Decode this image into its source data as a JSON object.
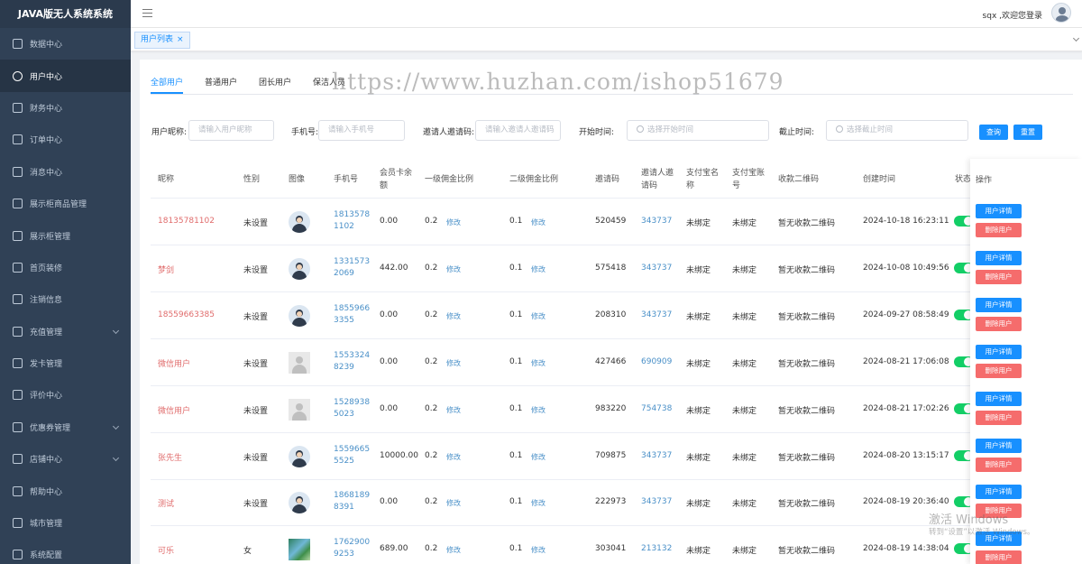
{
  "app": {
    "title": "JAVA版无人系统系统"
  },
  "sidebar": {
    "items": [
      {
        "label": "数据中心",
        "active": false,
        "arrow": false,
        "icon": "monitor-icon"
      },
      {
        "label": "用户中心",
        "active": true,
        "arrow": false,
        "icon": "user-icon"
      },
      {
        "label": "财务中心",
        "active": false,
        "arrow": false,
        "icon": "wallet-icon"
      },
      {
        "label": "订单中心",
        "active": false,
        "arrow": false,
        "icon": "document-icon"
      },
      {
        "label": "消息中心",
        "active": false,
        "arrow": false,
        "icon": "message-icon"
      },
      {
        "label": "展示柜商品管理",
        "active": false,
        "arrow": false,
        "icon": "box-icon"
      },
      {
        "label": "展示柜管理",
        "active": false,
        "arrow": false,
        "icon": "cabinet-icon"
      },
      {
        "label": "首页装修",
        "active": false,
        "arrow": false,
        "icon": "box-icon"
      },
      {
        "label": "注销信息",
        "active": false,
        "arrow": false,
        "icon": "pie-icon"
      },
      {
        "label": "充值管理",
        "active": false,
        "arrow": true,
        "icon": "wallet-icon"
      },
      {
        "label": "发卡管理",
        "active": false,
        "arrow": false,
        "icon": "card-icon"
      },
      {
        "label": "评价中心",
        "active": false,
        "arrow": false,
        "icon": "chat-icon"
      },
      {
        "label": "优惠券管理",
        "active": false,
        "arrow": true,
        "icon": "tag-icon"
      },
      {
        "label": "店铺中心",
        "active": false,
        "arrow": true,
        "icon": "shop-icon"
      },
      {
        "label": "帮助中心",
        "active": false,
        "arrow": false,
        "icon": "help-icon"
      },
      {
        "label": "城市管理",
        "active": false,
        "arrow": false,
        "icon": "chart-icon"
      },
      {
        "label": "系统配置",
        "active": false,
        "arrow": false,
        "icon": "settings-icon"
      }
    ]
  },
  "header": {
    "welcome": "sqx ,欢迎您登录"
  },
  "tagsbar": {
    "tab_label": "用户列表",
    "close": "×"
  },
  "watermark": "https://www.huzhan.com/ishop51679",
  "tabs": [
    "全部用户",
    "普通用户",
    "团长用户",
    "保洁人员"
  ],
  "filters": {
    "nickname_label": "用户昵称:",
    "nickname_placeholder": "请输入用户昵称",
    "phone_label": "手机号:",
    "phone_placeholder": "请输入手机号",
    "invite_label": "邀请人邀请码:",
    "invite_placeholder": "请输入邀请人邀请码",
    "start_label": "开始时间:",
    "start_placeholder": "选择开始时间",
    "end_label": "截止时间:",
    "end_placeholder": "选择截止时间",
    "search_btn": "查询",
    "reset_btn": "重置"
  },
  "table": {
    "headers": {
      "nickname": "昵称",
      "gender": "性别",
      "image": "图像",
      "phone": "手机号",
      "balance_1": "会员卡余",
      "balance_2": "额",
      "level1": "一级佣金比例",
      "level2": "二级佣金比例",
      "code": "邀请码",
      "inviter_1": "邀请人邀",
      "inviter_2": "请码",
      "alipay_name_1": "支付宝名",
      "alipay_name_2": "称",
      "alipay_acc_1": "支付宝账",
      "alipay_acc_2": "号",
      "qr": "收款二维码",
      "created": "创建时间",
      "status": "状态",
      "ops": "操作"
    },
    "edit_label": "修改",
    "detail_btn": "用户详情",
    "delete_btn": "删除用户",
    "rows": [
      {
        "nickname": "18135781102",
        "gender": "未设置",
        "avatar": "cartoon",
        "phone1": "1813578",
        "phone2": "1102",
        "balance": "0.00",
        "l1": "0.2",
        "l2": "0.1",
        "code": "520459",
        "inviter": "343737",
        "alipay_name": "未绑定",
        "alipay_acc": "未绑定",
        "qr": "暂无收款二维码",
        "created": "2024-10-18 16:23:11"
      },
      {
        "nickname": "梦剑",
        "gender": "未设置",
        "avatar": "cartoon",
        "phone1": "1331573",
        "phone2": "2069",
        "balance": "442.00",
        "l1": "0.2",
        "l2": "0.1",
        "code": "575418",
        "inviter": "343737",
        "alipay_name": "未绑定",
        "alipay_acc": "未绑定",
        "qr": "暂无收款二维码",
        "created": "2024-10-08 10:49:56"
      },
      {
        "nickname": "18559663385",
        "gender": "未设置",
        "avatar": "cartoon",
        "phone1": "1855966",
        "phone2": "3355",
        "balance": "0.00",
        "l1": "0.2",
        "l2": "0.1",
        "code": "208310",
        "inviter": "343737",
        "alipay_name": "未绑定",
        "alipay_acc": "未绑定",
        "qr": "暂无收款二维码",
        "created": "2024-09-27 08:58:49"
      },
      {
        "nickname": "微信用户",
        "gender": "未设置",
        "avatar": "plain",
        "phone1": "1553324",
        "phone2": "8239",
        "balance": "0.00",
        "l1": "0.2",
        "l2": "0.1",
        "code": "427466",
        "inviter": "690909",
        "alipay_name": "未绑定",
        "alipay_acc": "未绑定",
        "qr": "暂无收款二维码",
        "created": "2024-08-21 17:06:08"
      },
      {
        "nickname": "微信用户",
        "gender": "未设置",
        "avatar": "plain",
        "phone1": "1528938",
        "phone2": "5023",
        "balance": "0.00",
        "l1": "0.2",
        "l2": "0.1",
        "code": "983220",
        "inviter": "754738",
        "alipay_name": "未绑定",
        "alipay_acc": "未绑定",
        "qr": "暂无收款二维码",
        "created": "2024-08-21 17:02:26"
      },
      {
        "nickname": "张先生",
        "gender": "未设置",
        "avatar": "cartoon",
        "phone1": "1559665",
        "phone2": "5525",
        "balance": "10000.00",
        "l1": "0.2",
        "l2": "0.1",
        "code": "709875",
        "inviter": "343737",
        "alipay_name": "未绑定",
        "alipay_acc": "未绑定",
        "qr": "暂无收款二维码",
        "created": "2024-08-20 13:15:17"
      },
      {
        "nickname": "测试",
        "gender": "未设置",
        "avatar": "cartoon",
        "phone1": "1868189",
        "phone2": "8391",
        "balance": "0.00",
        "l1": "0.2",
        "l2": "0.1",
        "code": "222973",
        "inviter": "343737",
        "alipay_name": "未绑定",
        "alipay_acc": "未绑定",
        "qr": "暂无收款二维码",
        "created": "2024-08-19 20:36:40"
      },
      {
        "nickname": "可乐",
        "gender": "女",
        "avatar": "photo",
        "phone1": "1762900",
        "phone2": "9253",
        "balance": "689.00",
        "l1": "0.2",
        "l2": "0.1",
        "code": "303041",
        "inviter": "213132",
        "alipay_name": "未绑定",
        "alipay_acc": "未绑定",
        "qr": "暂无收款二维码",
        "created": "2024-08-19 14:38:04"
      }
    ]
  },
  "os_watermark": {
    "line1": "激活 Windows",
    "line2": "转到“设置”以激活 Windows。"
  }
}
